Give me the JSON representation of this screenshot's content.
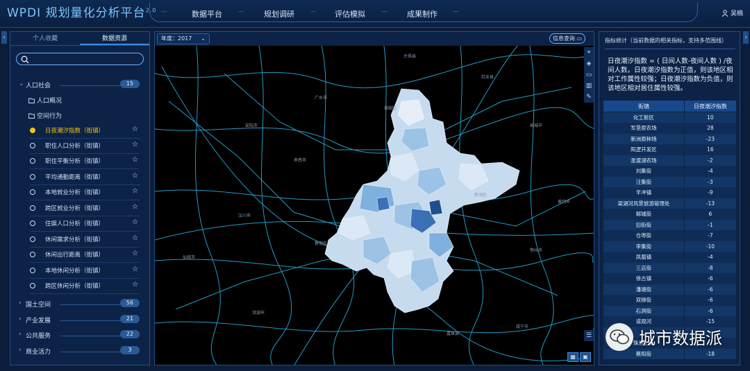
{
  "header": {
    "logo": "WPDI 规划量化分析平台",
    "version": "2.0",
    "nav": [
      "数据平台",
      "规划调研",
      "评估模拟",
      "成果制作"
    ],
    "user": "吴楠"
  },
  "left_panel": {
    "tabs": [
      "个人收藏",
      "数据资源"
    ],
    "active_tab": "数据资源",
    "search_placeholder": "",
    "categories": [
      {
        "name": "人口社会",
        "count": "15"
      },
      {
        "name": "国土空间",
        "count": "56"
      },
      {
        "name": "产业发展",
        "count": "21"
      },
      {
        "name": "公共服务",
        "count": "22"
      },
      {
        "name": "商业活力",
        "count": "3"
      }
    ],
    "folders": [
      "人口概况",
      "空间行为"
    ],
    "items": [
      "日夜潮汐指数（街镇）",
      "职住人口分析（街镇）",
      "职住平衡分析（街镇）",
      "平均通勤距离（街镇）",
      "本地就业分析（街镇）",
      "跨区就业分析（街镇）",
      "住娱人口分析（街镇）",
      "休闲需求分析（街镇）",
      "休闲出行距离（街镇）",
      "本地休闲分析（街镇）",
      "跨区休闲分析（街镇）"
    ],
    "active_item": "日夜潮汐指数（街镇）"
  },
  "map": {
    "year_label": "年度：2017",
    "query_button": "信息查询",
    "labels": [
      {
        "text": "大悟县"
      },
      {
        "text": "红安县"
      },
      {
        "text": "广水市"
      },
      {
        "text": "麻城市"
      },
      {
        "text": "安陆市"
      },
      {
        "text": "孝感市"
      },
      {
        "text": "汉川市"
      },
      {
        "text": "黄冈市"
      },
      {
        "text": "鄂州市"
      },
      {
        "text": "仙桃市"
      },
      {
        "text": "嘉鱼县"
      },
      {
        "text": "咸宁市"
      },
      {
        "text": "蔡甸区"
      },
      {
        "text": "新洲区"
      },
      {
        "text": "黄陂区"
      },
      {
        "text": "洪湖市"
      }
    ],
    "colors": {
      "choropleth_light": "#dbe8f5",
      "choropleth_mid": "#9cc3e6",
      "choropleth_dark": "#3b6fb6",
      "roads": "#2bb8e8"
    }
  },
  "right_panel": {
    "heading": "指标统计（当前数据的相关指标，支持多范围线）",
    "description": "日夜潮汐指数 = ( 日间人数-夜间人数 ) /夜间人数。日夜潮汐指数为正值，则该地区相对工作属性较强；日夜潮汐指数为负值，则该地区相对居住属性较强。",
    "table": {
      "headers": [
        "街镇",
        "日夜潮汐指数"
      ],
      "rows": [
        [
          "化工新区",
          "10"
        ],
        [
          "军垦原农场",
          "28"
        ],
        [
          "新洲原种场",
          "-23"
        ],
        [
          "阳逻开发区",
          "16"
        ],
        [
          "涨渡湖农场",
          "-2"
        ],
        [
          "刘集街",
          "-4"
        ],
        [
          "汪集街",
          "-3"
        ],
        [
          "辛冲镇",
          "-9"
        ],
        [
          "梁湖河风景旅游管理处",
          "-13"
        ],
        [
          "邾城街",
          "6"
        ],
        [
          "旧街街",
          "-1"
        ],
        [
          "仓埠街",
          "-7"
        ],
        [
          "李集街",
          "-10"
        ],
        [
          "凤凰镇",
          "-4"
        ],
        [
          "三店街",
          "-8"
        ],
        [
          "徐古镇",
          "-6"
        ],
        [
          "潘塘街",
          "-6"
        ],
        [
          "双柳街",
          "-6"
        ],
        [
          "石洞街",
          "-6"
        ],
        [
          "道观河",
          "-15"
        ],
        [
          "",
          "-"
        ],
        [
          "珠港山街",
          "-"
        ],
        [
          "蔡阳街",
          "-18"
        ]
      ]
    }
  },
  "watermark": "城市数据派"
}
